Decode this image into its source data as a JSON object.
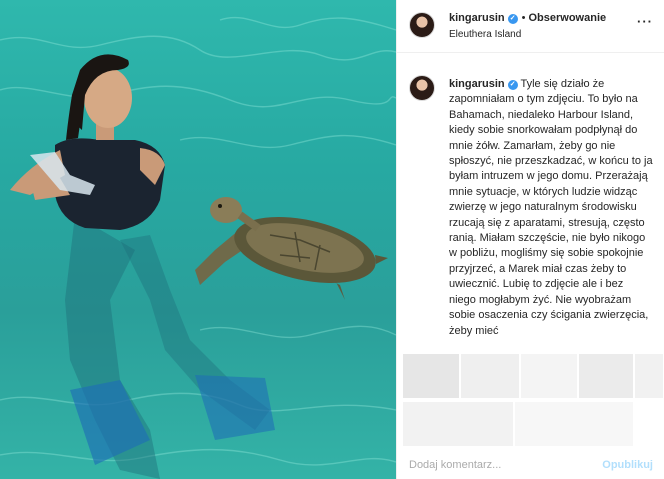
{
  "post": {
    "username": "kingarusin",
    "follow_label": "Obserwowanie",
    "location": "Eleuthera Island",
    "more_label": "···"
  },
  "caption": {
    "username": "kingarusin",
    "text": "Tyle się działo że zapomniałam o tym zdjęciu. To było na Bahamach, niedaleko Harbour Island, kiedy sobie snorkowałam podpłynął do mnie żółw. Zamarłam, żeby go nie spłoszyć, nie przeszkadzać, w końcu to ja byłam intruzem w jego domu. Przerażają mnie sytuacje, w których ludzie widząc zwierzę w jego naturalnym środowisku rzucają się z aparatami, stresują, często ranią. Miałam szczęście, nie było nikogo w pobliżu, mogliśmy się sobie spokojnie przyjrzeć, a Marek miał czas żeby to uwiecznić. Lubię to zdjęcie ale i bez niego mogłabym żyć. Nie wyobrażam sobie osaczenia czy ścigania zwierzęcia, żeby mieć"
  },
  "comment": {
    "placeholder": "Dodaj komentarz...",
    "publish_label": "Opublikuj"
  },
  "colors": {
    "accent": "#3897f0",
    "water": "#2aa9a2"
  },
  "icons": [
    "verified-badge-icon",
    "more-options-icon"
  ]
}
